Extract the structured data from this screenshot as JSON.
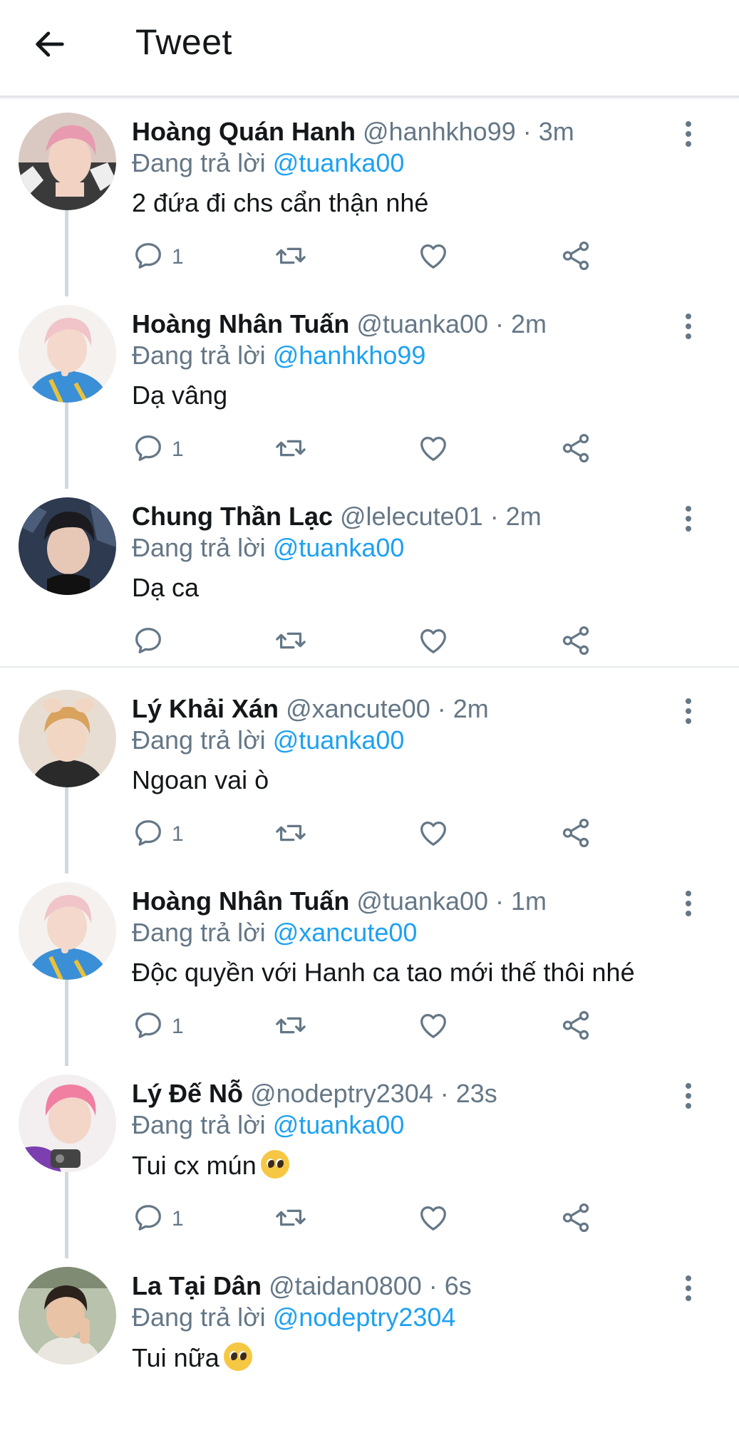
{
  "header": {
    "title": "Tweet",
    "back_icon": "arrow-left-icon"
  },
  "colors": {
    "accent": "#1da1f2",
    "secondary_text": "#657786",
    "primary_text": "#14171a",
    "thread_line": "#cfd9de"
  },
  "reply_prefix": "Đang trả lời",
  "tweets": [
    {
      "name": "Hoàng Quán Hanh",
      "meta": "@hanhkho99 · 3m",
      "reply_to": "@tuanka00",
      "text": "2 đứa đi chs cẩn thận nhé",
      "reply_count": "1"
    },
    {
      "name": "Hoàng Nhân Tuấn",
      "meta": "@tuanka00 · 2m",
      "reply_to": "@hanhkho99",
      "text": "Dạ vâng",
      "reply_count": "1"
    },
    {
      "name": "Chung Thần Lạc",
      "meta": "@lelecute01 · 2m",
      "reply_to": "@tuanka00",
      "text": "Dạ ca",
      "reply_count": ""
    },
    {
      "name": "Lý Khải Xán",
      "meta": "@xancute00 · 2m",
      "reply_to": "@tuanka00",
      "text": "Ngoan vai ò",
      "reply_count": "1"
    },
    {
      "name": "Hoàng Nhân Tuấn",
      "meta": "@tuanka00 · 1m",
      "reply_to": "@xancute00",
      "text": "Độc quyền với Hanh ca tao mới thế thôi nhé",
      "reply_count": "1"
    },
    {
      "name": "Lý Đế Nỗ",
      "meta": "@nodeptry2304 · 23s",
      "reply_to": "@tuanka00",
      "text": "Tui cx mún",
      "emoji": "pleading-face-emoji",
      "reply_count": "1"
    },
    {
      "name": "La Tại Dân",
      "meta": "@taidan0800 · 6s",
      "reply_to": "@nodeptry2304",
      "text": "Tui nữa",
      "emoji": "pleading-face-emoji",
      "reply_count": ""
    }
  ]
}
